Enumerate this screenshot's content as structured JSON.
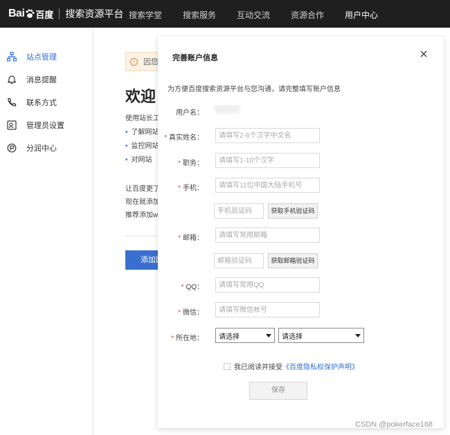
{
  "topnav": {
    "logo_bai": "Bai",
    "logo_du": "百度",
    "platform": "搜索资源平台",
    "items": [
      {
        "label": "搜索学堂"
      },
      {
        "label": "搜索服务"
      },
      {
        "label": "互动交流"
      },
      {
        "label": "资源合作"
      },
      {
        "label": "用户中心"
      }
    ]
  },
  "sidebar": {
    "items": [
      {
        "label": "站点管理",
        "icon": "site-icon"
      },
      {
        "label": "消息提醒",
        "icon": "bell-icon"
      },
      {
        "label": "联系方式",
        "icon": "phone-icon"
      },
      {
        "label": "管理员设置",
        "icon": "admin-icon"
      },
      {
        "label": "分润中心",
        "icon": "revenue-icon"
      }
    ]
  },
  "background": {
    "notice": "因您",
    "welcome": "欢迎",
    "intro": "使用站长工",
    "bullets": [
      "了解网站",
      "监控网站",
      "对网站"
    ],
    "para": [
      "让百度更了",
      "现在就添加",
      "推荐添加w"
    ],
    "add_button": "添加网"
  },
  "modal": {
    "title": "完善账户信息",
    "intro": "为方便百度搜索资源平台与您沟通，请完整填写账户信息",
    "username_label": "用户名：",
    "fields": {
      "realname": {
        "label": "真实姓名：",
        "placeholder": "请填写2-6个汉字中文名"
      },
      "position": {
        "label": "职务：",
        "placeholder": "请填写1-10个汉字"
      },
      "phone": {
        "label": "手机：",
        "placeholder": "请填写11位中国大陆手机号"
      },
      "phone_code": {
        "placeholder": "手机验证码",
        "button": "获取手机验证码"
      },
      "email": {
        "label": "邮箱：",
        "placeholder": "请填写常用邮箱"
      },
      "email_code": {
        "placeholder": "邮箱验证码",
        "button": "获取邮箱验证码"
      },
      "qq": {
        "label": "QQ：",
        "placeholder": "请填写常用QQ"
      },
      "wechat": {
        "label": "微信：",
        "placeholder": "请填写微信帐号"
      },
      "location": {
        "label": "所在地：",
        "select1": "请选择",
        "select2": "请选择"
      }
    },
    "agree_text": "我已阅读并接受",
    "agree_link": "《百度隐私权保护声明》",
    "save": "保存"
  },
  "watermark": "CSDN @pokerface168",
  "colors": {
    "accent": "#2e6fd8",
    "required": "#e23b3b",
    "nav_bg": "#1f1f1f"
  }
}
